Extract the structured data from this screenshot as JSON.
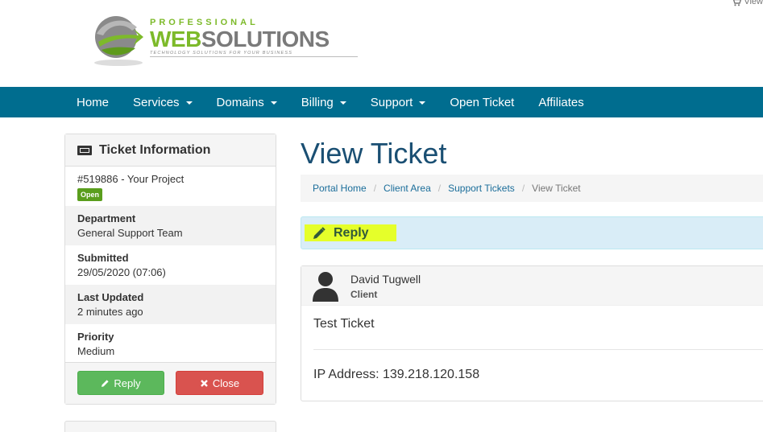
{
  "header": {
    "cart_label": "View",
    "logo": {
      "top": "PROFESSIONAL",
      "main_a": "WEB",
      "main_b": "SOLUTIONS",
      "tagline": "TECHNOLOGY SOLUTIONS FOR YOUR BUSINESS"
    }
  },
  "nav": {
    "items": [
      {
        "label": "Home",
        "dropdown": false
      },
      {
        "label": "Services",
        "dropdown": true
      },
      {
        "label": "Domains",
        "dropdown": true
      },
      {
        "label": "Billing",
        "dropdown": true
      },
      {
        "label": "Support",
        "dropdown": true
      },
      {
        "label": "Open Ticket",
        "dropdown": false
      },
      {
        "label": "Affiliates",
        "dropdown": false
      }
    ]
  },
  "sidebar": {
    "title": "Ticket Information",
    "ticket_ref": "#519886 - Your Project",
    "status": "Open",
    "department_label": "Department",
    "department": "General Support Team",
    "submitted_label": "Submitted",
    "submitted": "29/05/2020 (07:06)",
    "updated_label": "Last Updated",
    "updated": "2 minutes ago",
    "priority_label": "Priority",
    "priority": "Medium",
    "reply_button": "Reply",
    "close_button": "Close"
  },
  "main": {
    "title": "View Ticket",
    "breadcrumb": [
      "Portal Home",
      "Client Area",
      "Support Tickets",
      "View Ticket"
    ],
    "reply_label": "Reply",
    "message": {
      "author": "David Tugwell",
      "role": "Client",
      "body": "Test Ticket",
      "ip": "IP Address: 139.218.120.158"
    }
  },
  "colors": {
    "nav_bg": "#006d8f",
    "title": "#1a4f73",
    "badge_open": "#5a9e1d",
    "reply_btn": "#5cb85c",
    "close_btn": "#d9534f",
    "reply_bar": "#d9edf7",
    "highlight": "#e5ff2a"
  }
}
